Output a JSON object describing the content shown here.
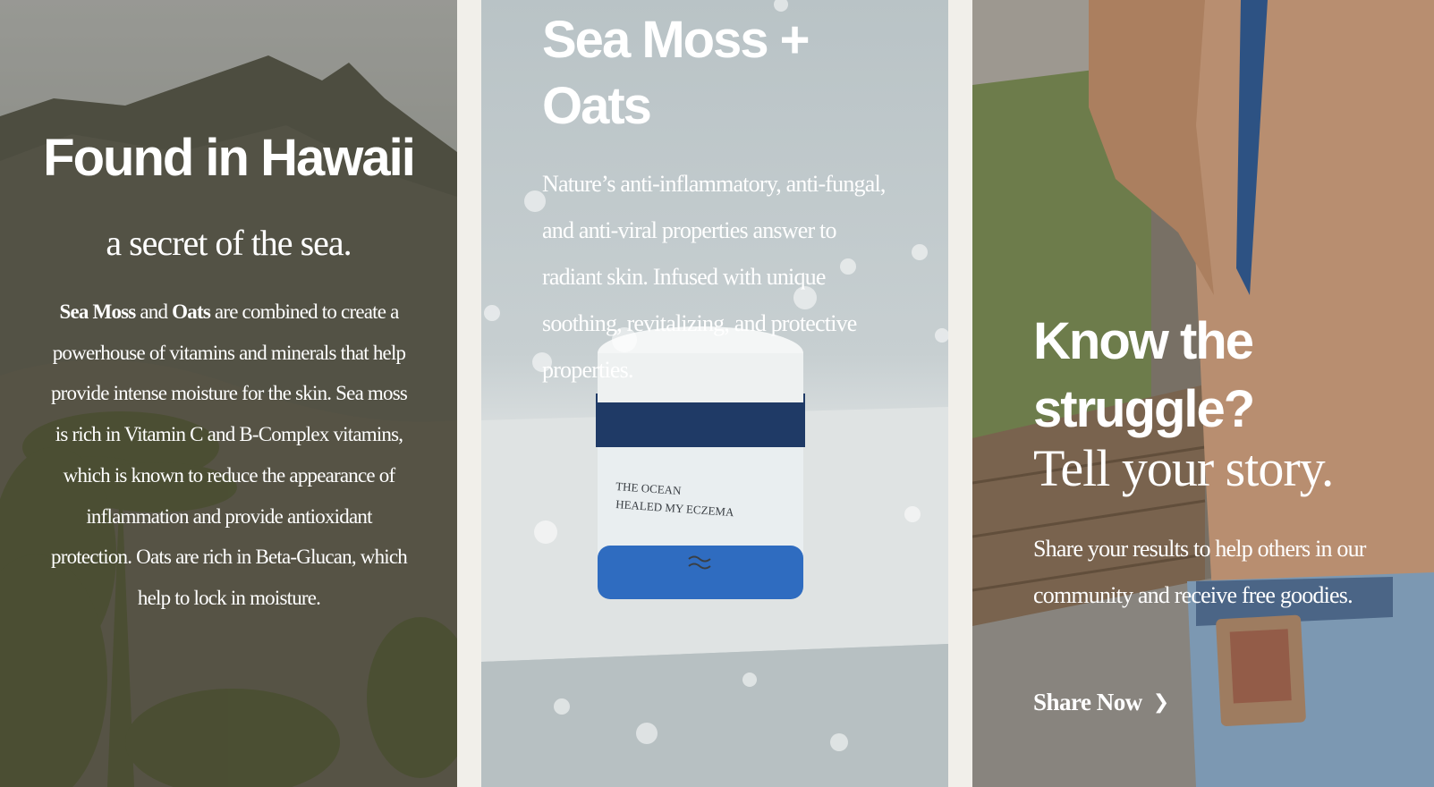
{
  "panel_hawaii": {
    "title": "Found in Hawaii",
    "subtitle": "a secret of the sea.",
    "body_b1": "Sea Moss",
    "body_t1": " and ",
    "body_b2": "Oats",
    "body_t2": " are combined to create a powerhouse of vitamins and minerals that help provide intense moisture for the skin. Sea moss is rich in Vitamin C and B-Complex vitamins, which is known to reduce the appearance of inflammation and provide antioxidant protection. Oats are rich in Beta-Glucan, which help to lock in moisture."
  },
  "panel_product": {
    "title": "Sea Moss + Oats",
    "body": "Nature’s anti-inflammatory, anti-fungal, and anti-viral properties answer to radiant skin. Infused with unique soothing, revitalizing, and protective properties.",
    "jar_label_line1": "THE OCEAN",
    "jar_label_line2": "HEALED MY ECZEMA"
  },
  "panel_story": {
    "title": "Know the struggle?",
    "subtitle": "Tell your story.",
    "body": "Share your results to help others in our community and receive free goodies.",
    "cta_label": "Share Now"
  },
  "colors": {
    "page_bg": "#f1efea",
    "text": "#ffffff",
    "jar_blue": "#2f6cc0"
  },
  "icons": {
    "cta_chevron": "chevron-right-icon"
  }
}
